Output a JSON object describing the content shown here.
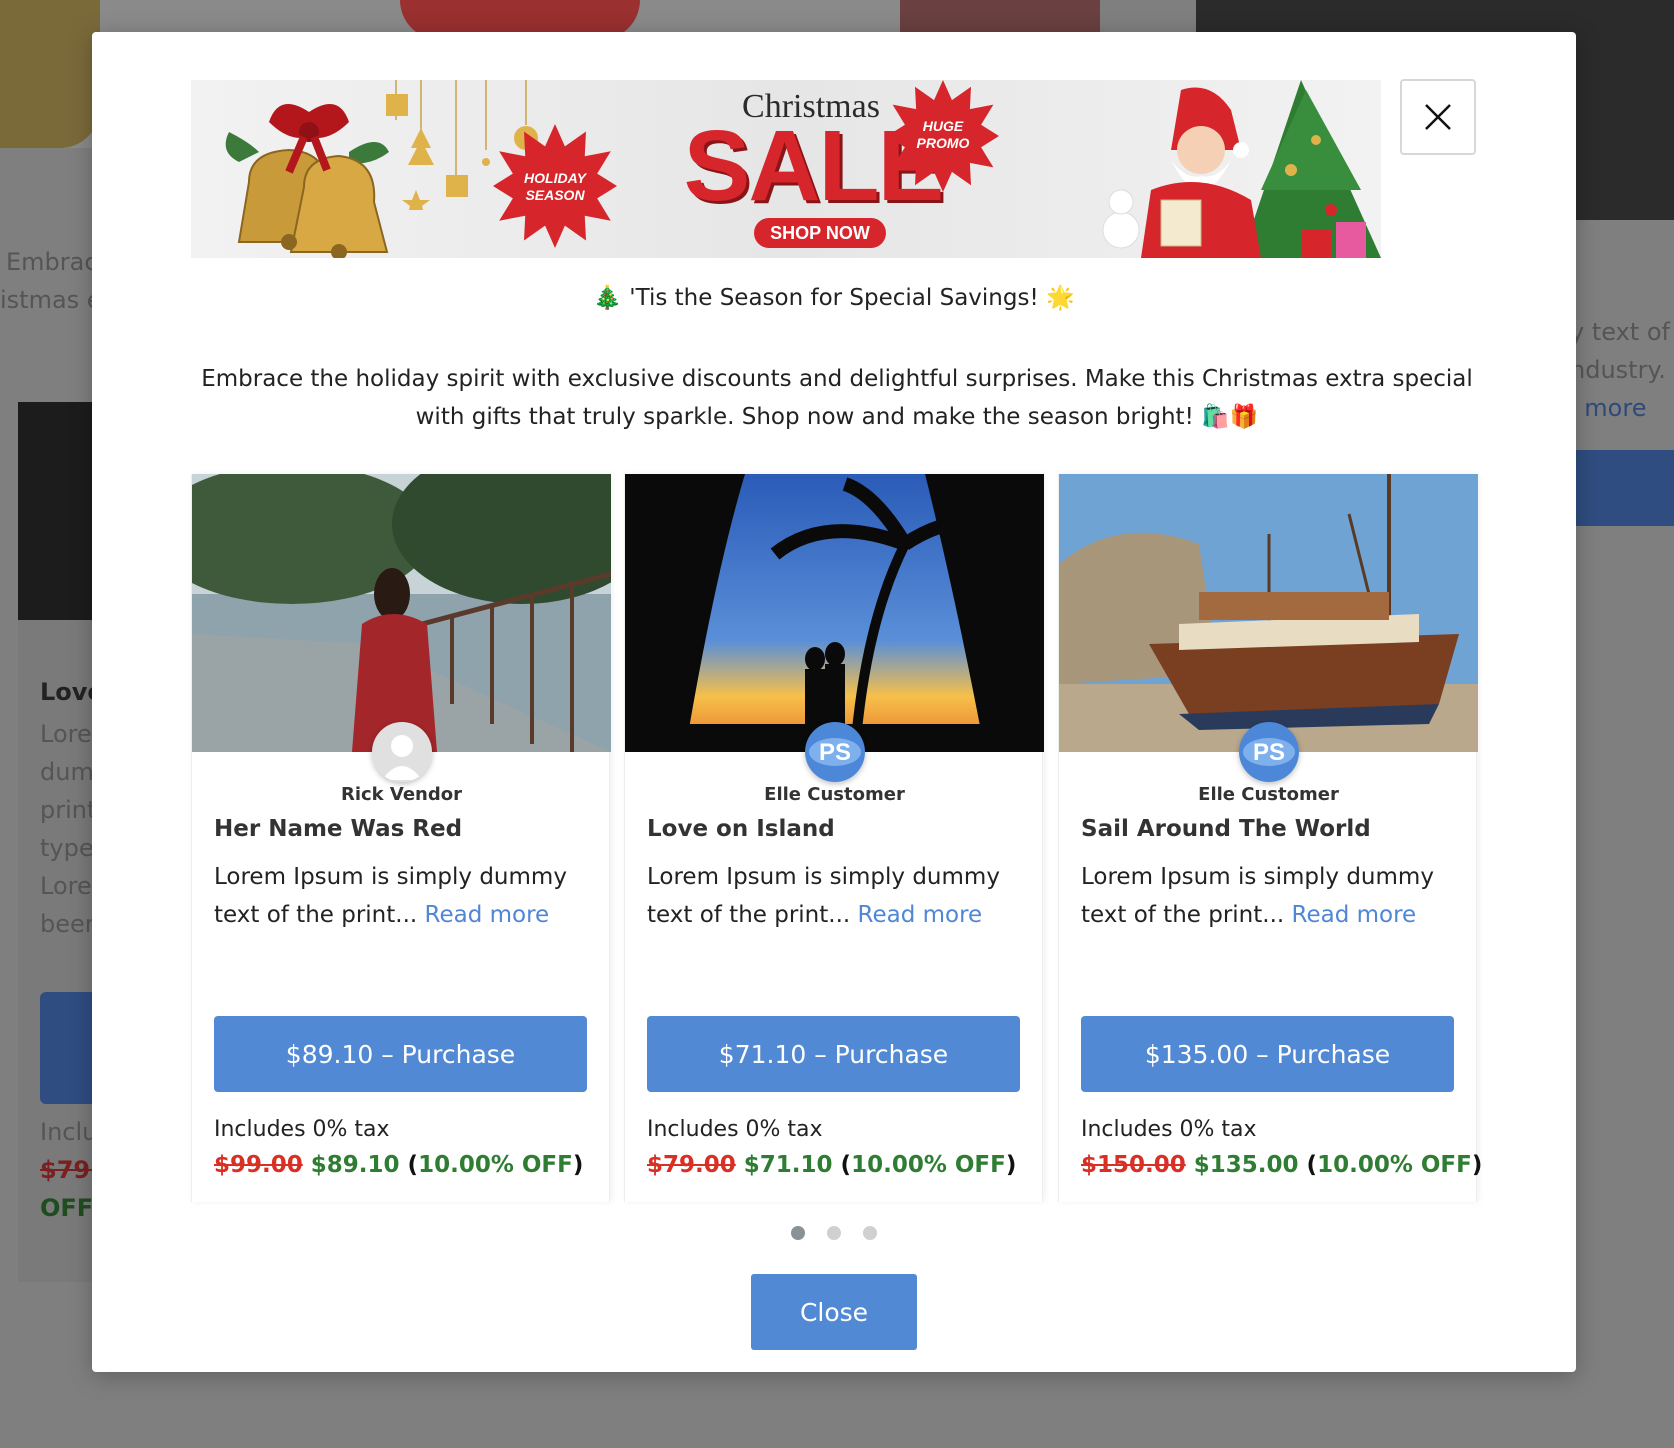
{
  "background": {
    "text_left_1": "Embrac",
    "text_left_2": "istmas e",
    "card_title": "Love",
    "card_lines": [
      "Lore",
      "dum",
      "print",
      "type",
      "Lore",
      "been"
    ],
    "card_inc": "Inclu",
    "card_old": "$79.",
    "card_off": "OFF",
    "text_right_1": "y text of",
    "text_right_2": "ndustry.",
    "text_right_3": "l more"
  },
  "modal": {
    "banner": {
      "title": "Christmas",
      "sale": "SALE",
      "shop_now": "SHOP NOW",
      "burst_left": "HOLIDAY SEASON",
      "burst_right": "HUGE PROMO"
    },
    "headline": "🎄 'Tis the Season for Special Savings! 🌟",
    "description": "Embrace the holiday spirit with exclusive discounts and delightful surprises. Make this Christmas extra special with gifts that truly sparkle. Shop now and make the season bright! 🛍️🎁",
    "close_label": "Close",
    "products": [
      {
        "vendor": "Rick Vendor",
        "title": "Her Name Was Red",
        "excerpt": "Lorem Ipsum is simply dummy text of the print... ",
        "read_more": "Read more",
        "button": "$89.10 – Purchase",
        "tax": "Includes 0% tax",
        "old_price": "$99.00",
        "new_price": "$89.10",
        "discount": "10.00% OFF",
        "avatar": "default-user-avatar"
      },
      {
        "vendor": "Elle Customer",
        "title": "Love on Island",
        "excerpt": "Lorem Ipsum is simply dummy text of the print... ",
        "read_more": "Read more",
        "button": "$71.10 – Purchase",
        "tax": "Includes 0% tax",
        "old_price": "$79.00",
        "new_price": "$71.10",
        "discount": "10.00% OFF",
        "avatar": "ps-logo-avatar"
      },
      {
        "vendor": "Elle Customer",
        "title": "Sail Around The World",
        "excerpt": "Lorem Ipsum is simply dummy text of the print... ",
        "read_more": "Read more",
        "button": "$135.00 – Purchase",
        "tax": "Includes 0% tax",
        "old_price": "$150.00",
        "new_price": "$135.00",
        "discount": "10.00% OFF",
        "avatar": "ps-logo-avatar"
      }
    ],
    "carousel": {
      "pages": 3,
      "active_page": 1
    }
  },
  "colors": {
    "primary_button": "#5289d4",
    "link": "#4f86d6",
    "old_price": "#d93025",
    "new_price": "#2e7d32",
    "banner_red": "#d6262c"
  }
}
